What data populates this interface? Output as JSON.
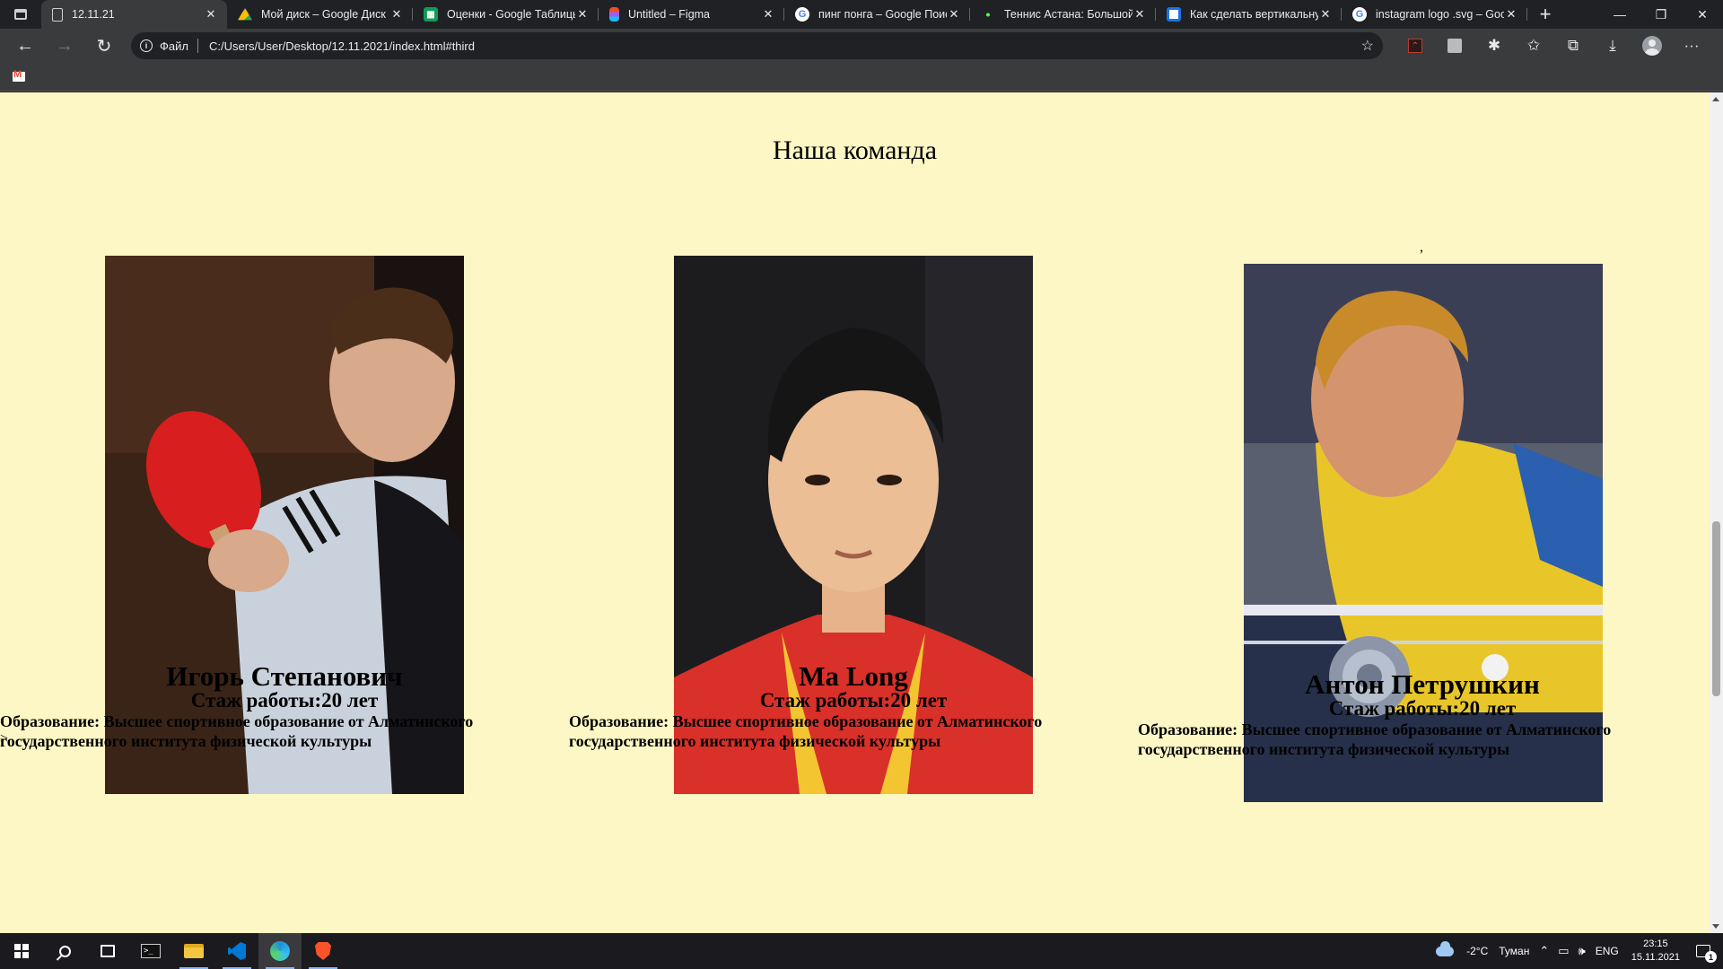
{
  "browser": {
    "tabs": [
      {
        "title": "12.11.21",
        "favicon": "page-icon",
        "active": true
      },
      {
        "title": "Мой диск – Google Диск",
        "favicon": "google-drive-icon"
      },
      {
        "title": "Оценки - Google Таблицы",
        "favicon": "google-sheets-icon"
      },
      {
        "title": "Untitled – Figma",
        "favicon": "figma-icon"
      },
      {
        "title": "пинг понга – Google Поиск",
        "favicon": "google-icon"
      },
      {
        "title": "Теннис Астана: Большой",
        "favicon": "site-dot-icon"
      },
      {
        "title": "Как сделать вертикальну",
        "favicon": "blue-square-icon"
      },
      {
        "title": "instagram logo .svg – Goo",
        "favicon": "google-icon"
      }
    ],
    "address": {
      "scheme_label": "Файл",
      "url": "C:/Users/User/Desktop/12.11.2021/index.html#third"
    },
    "bookmarks": [
      {
        "icon": "gmail-icon"
      }
    ]
  },
  "page": {
    "section_title": "Наша команда",
    "stray_marks": {
      "comma": ",",
      "gt": ">"
    },
    "team": [
      {
        "name": "Игорь Степанович",
        "experience": "Стаж работы:20 лет",
        "education": "Образование: Высшее спортивное образование от Алматинского государственного института физической культуры",
        "photo": "player-photo-red-paddle"
      },
      {
        "name": "Ma Long",
        "experience": "Стаж работы:20 лет",
        "education": "Образование: Высшее спортивное образование от Алматинского государственного института физической культуры",
        "photo": "player-photo-portrait"
      },
      {
        "name": "Антон Петрушкин",
        "experience": "Стаж работы:20 лет",
        "education": "Образование: Высшее спортивное образование от Алматинского государственного института физической культуры",
        "photo": "player-photo-yellow-shirt"
      }
    ]
  },
  "taskbar": {
    "apps": [
      "start",
      "search",
      "task-view",
      "terminal",
      "file-explorer",
      "vscode",
      "edge",
      "brave"
    ],
    "weather": {
      "temp": "-2°C",
      "condition": "Туман"
    },
    "language": "ENG",
    "time": "23:15",
    "date": "15.11.2021",
    "notifications": "1"
  },
  "colors": {
    "page_background": "#fcf7c4",
    "browser_chrome": "#3a3b3d",
    "tab_strip": "#202124"
  }
}
